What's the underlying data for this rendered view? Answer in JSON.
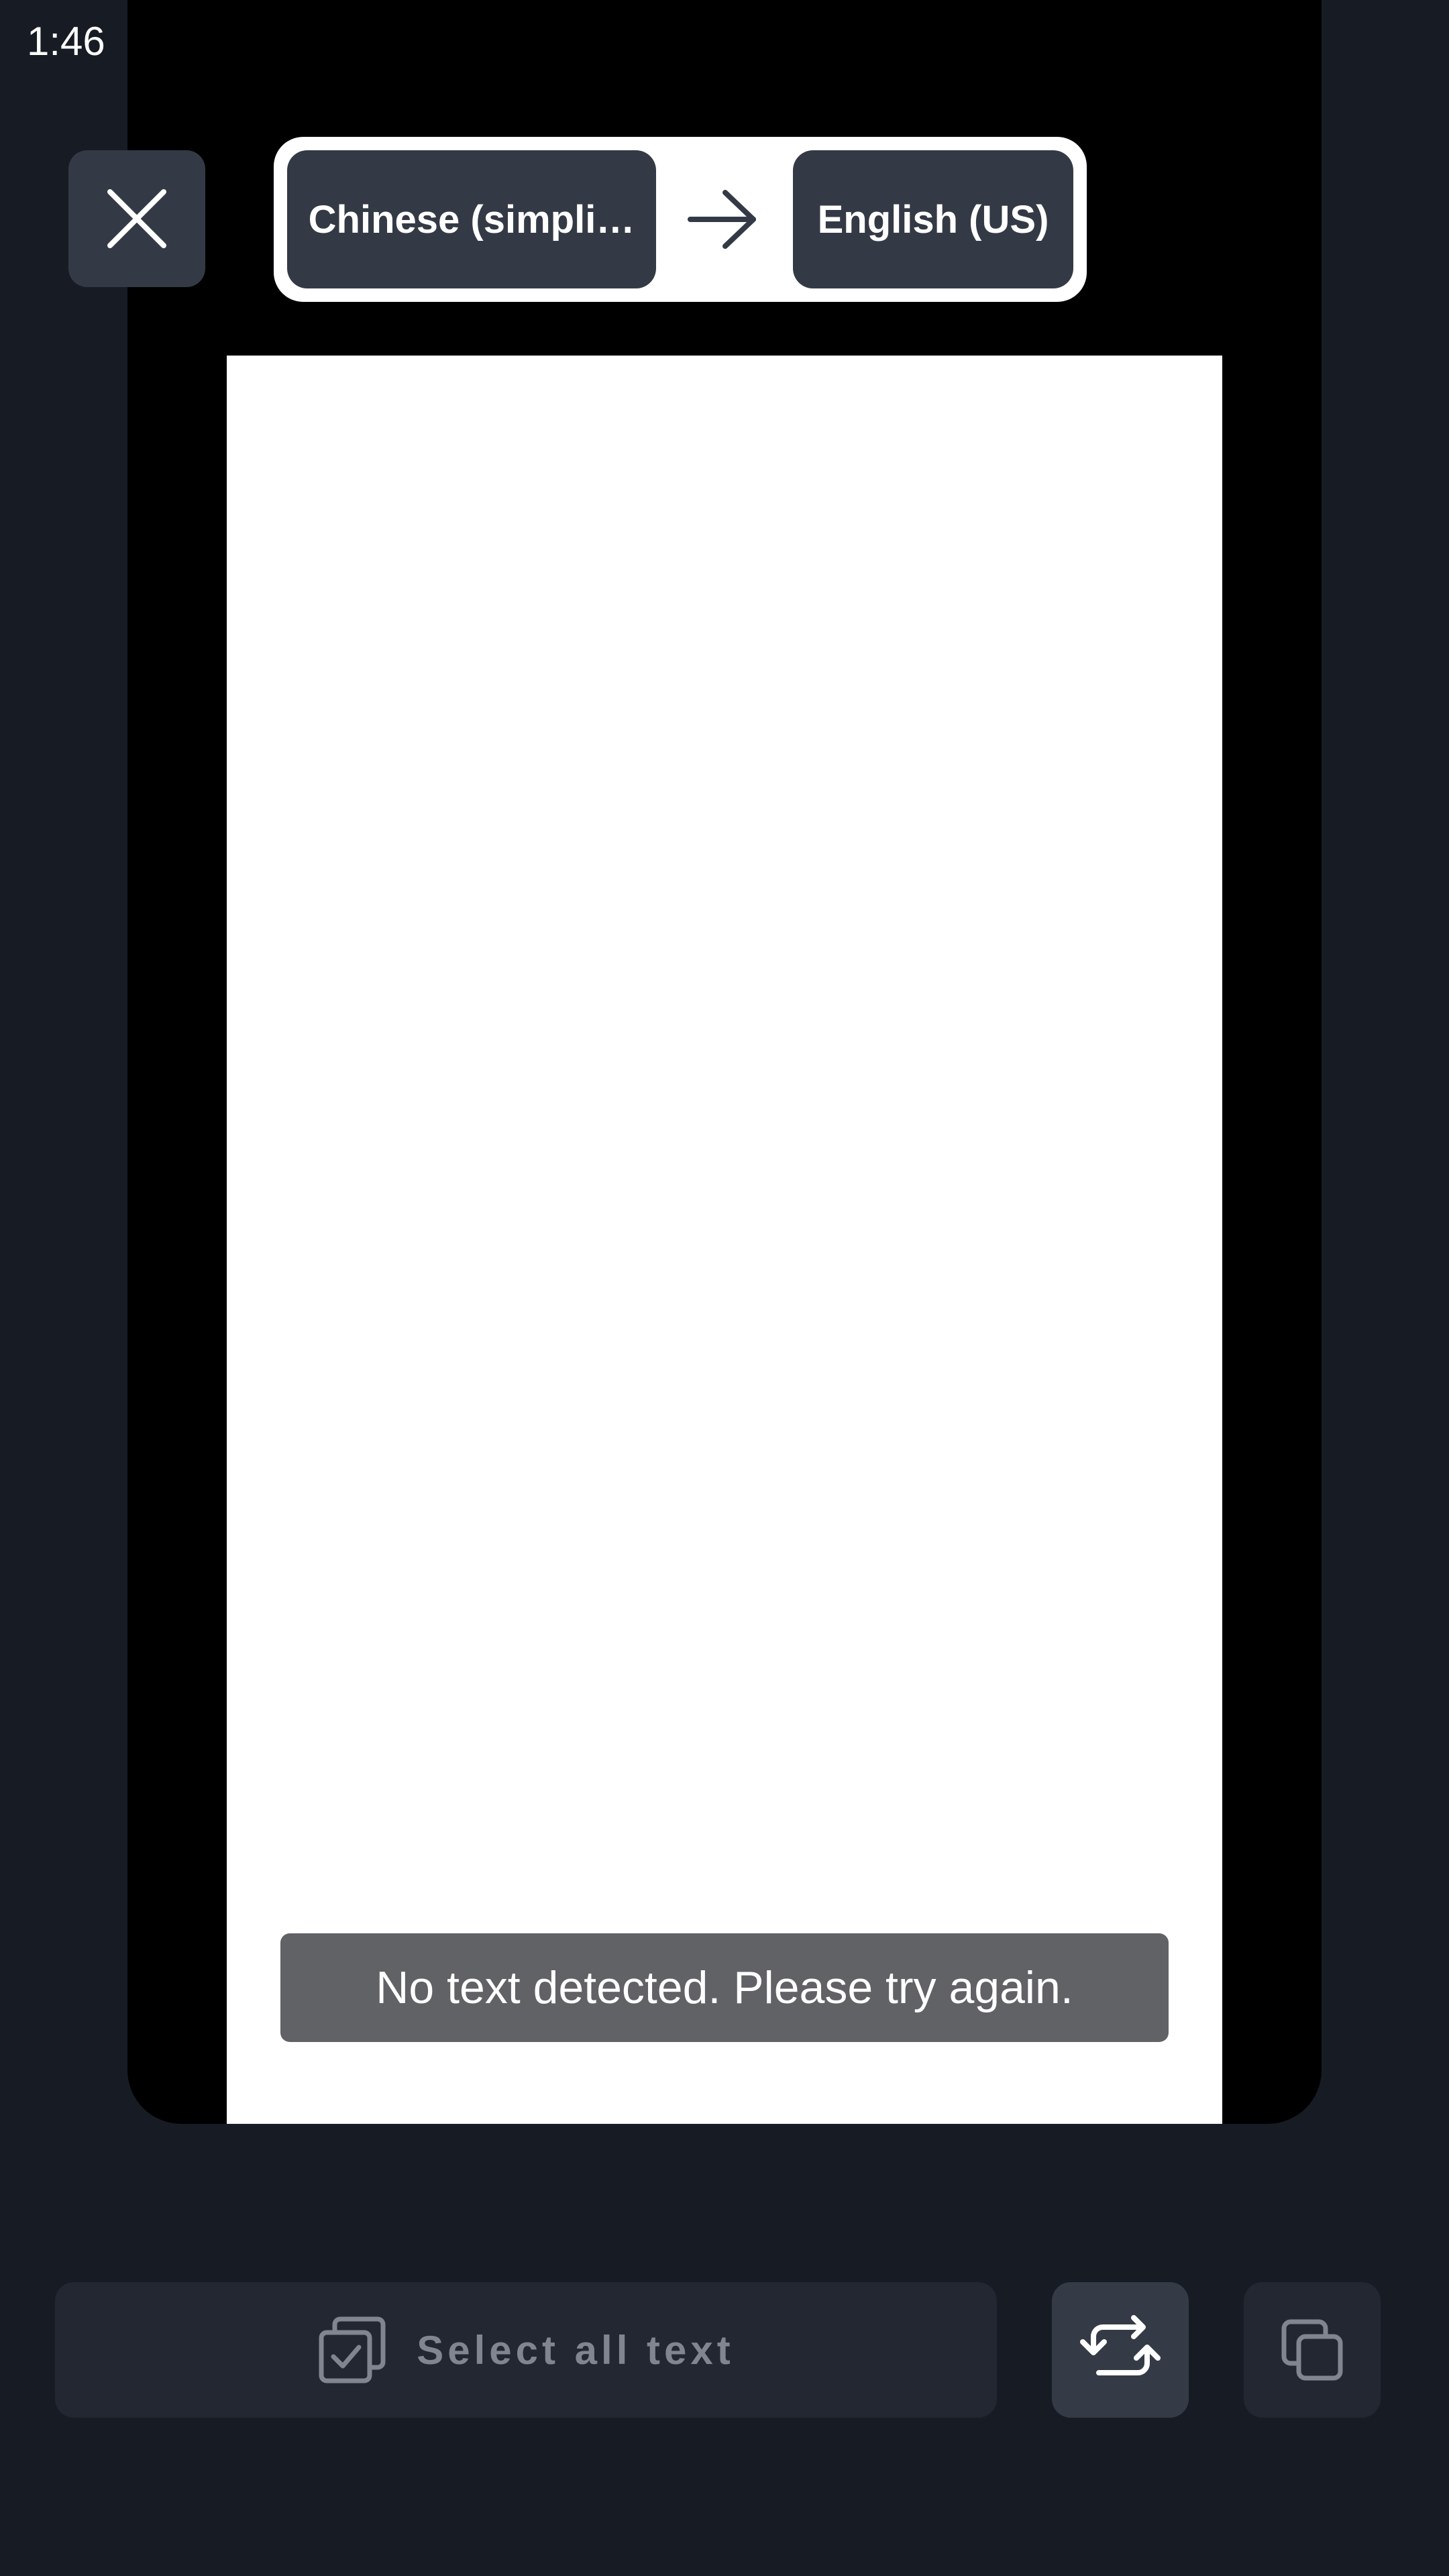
{
  "status_bar": {
    "time": "1:46",
    "app_icon": "firefox-style-app-icon"
  },
  "header": {
    "close_icon": "close-icon",
    "source_language": "Chinese (simpli…",
    "arrow_icon": "arrow-right-icon",
    "target_language": "English (US)"
  },
  "toast": {
    "message": "No text detected. Please try again."
  },
  "bottom_bar": {
    "select_all_label": "Select all text",
    "select_all_icon": "select-all-icon",
    "swap_icon": "swap-camera-icon",
    "copy_icon": "copy-icon"
  },
  "colors": {
    "background": "#171c24",
    "frame": "#000000",
    "button": "#343a45",
    "button_dim": "#222731",
    "toast": "#616266"
  }
}
